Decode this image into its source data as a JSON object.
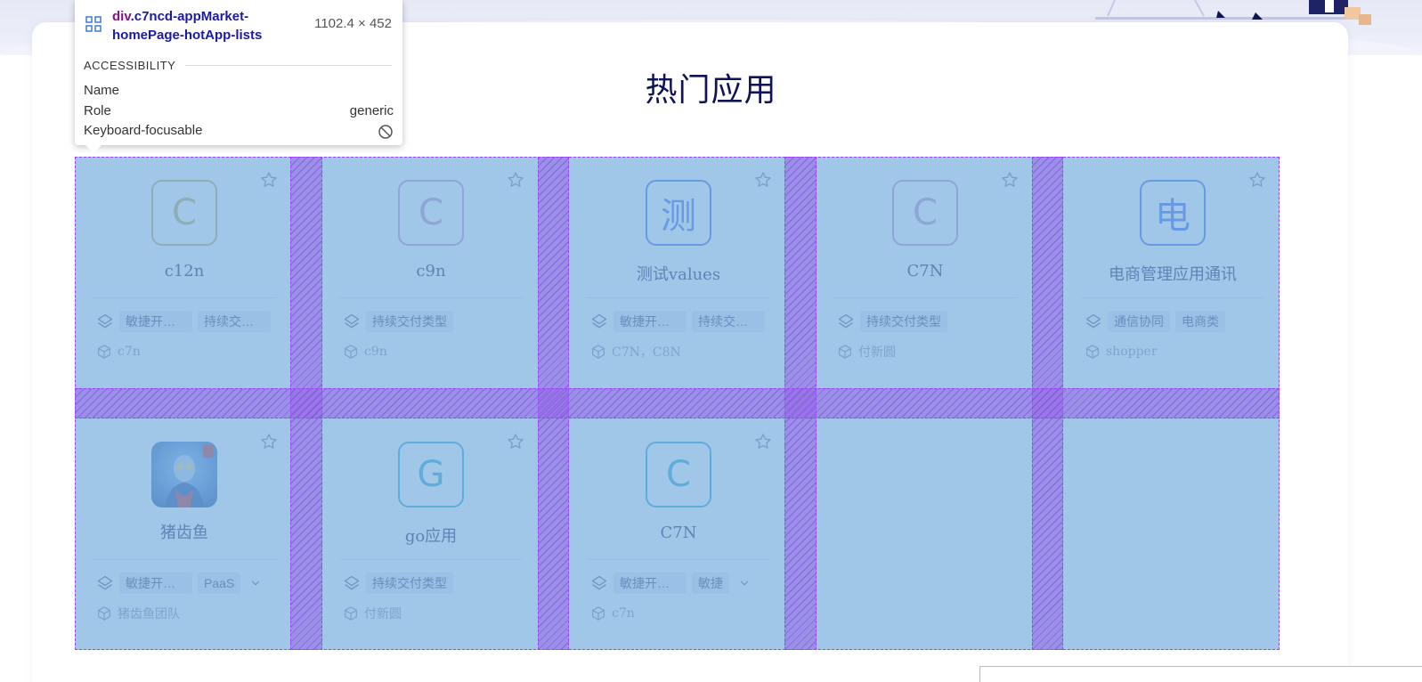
{
  "page": {
    "section_title": "热门应用"
  },
  "cards": [
    {
      "logo_text": "C",
      "logo_color": "#c8b96e",
      "name": "c12n",
      "tags": [
        "敏捷开发类型",
        "持续交付类型"
      ],
      "owner": "c7n",
      "has_more": false
    },
    {
      "logo_text": "C",
      "logo_color": "#c7a0c9",
      "name": "c9n",
      "tags": [
        "持续交付类型"
      ],
      "owner": "c9n",
      "has_more": false
    },
    {
      "logo_text": "测",
      "logo_color": "#5b7ef0",
      "name": "测试values",
      "tags": [
        "敏捷开发类型",
        "持续交付类型"
      ],
      "owner": "C7N，C8N",
      "has_more": false
    },
    {
      "logo_text": "C",
      "logo_color": "#c7a0c9",
      "name": "C7N",
      "tags": [
        "持续交付类型"
      ],
      "owner": "付新圆",
      "has_more": false
    },
    {
      "logo_text": "电",
      "logo_color": "#5b7ef0",
      "name": "电商管理应用通讯",
      "tags": [
        "通信协同",
        "电商类"
      ],
      "owner": "shopper",
      "has_more": false
    },
    {
      "logo_text": "",
      "logo_color": "#6a9be0",
      "logo_image": "ultraman-avatar",
      "name": "猪齿鱼",
      "tags": [
        "敏捷开发类型",
        "PaaS"
      ],
      "owner": "猪齿鱼团队",
      "has_more": true
    },
    {
      "logo_text": "G",
      "logo_color": "#45b3d6",
      "name": "go应用",
      "tags": [
        "持续交付类型"
      ],
      "owner": "付新圆",
      "has_more": false
    },
    {
      "logo_text": "C",
      "logo_color": "#45b3d6",
      "name": "C7N",
      "tags": [
        "敏捷开发类型",
        "敏捷"
      ],
      "owner": "c7n",
      "has_more": true
    }
  ],
  "devtools_tooltip": {
    "tag": "div",
    "selector": ".c7ncd-appMarket-homePage-hotApp-lists",
    "size": "1102.4 × 452",
    "section": "ACCESSIBILITY",
    "rows": [
      {
        "label": "Name",
        "value": ""
      },
      {
        "label": "Role",
        "value": "generic"
      },
      {
        "label": "Keyboard-focusable",
        "value": "",
        "icon": "blocked-icon"
      }
    ]
  },
  "colors": {
    "title": "#0f1358",
    "highlight": "#6fa8dc",
    "gap": "#9664e6"
  }
}
